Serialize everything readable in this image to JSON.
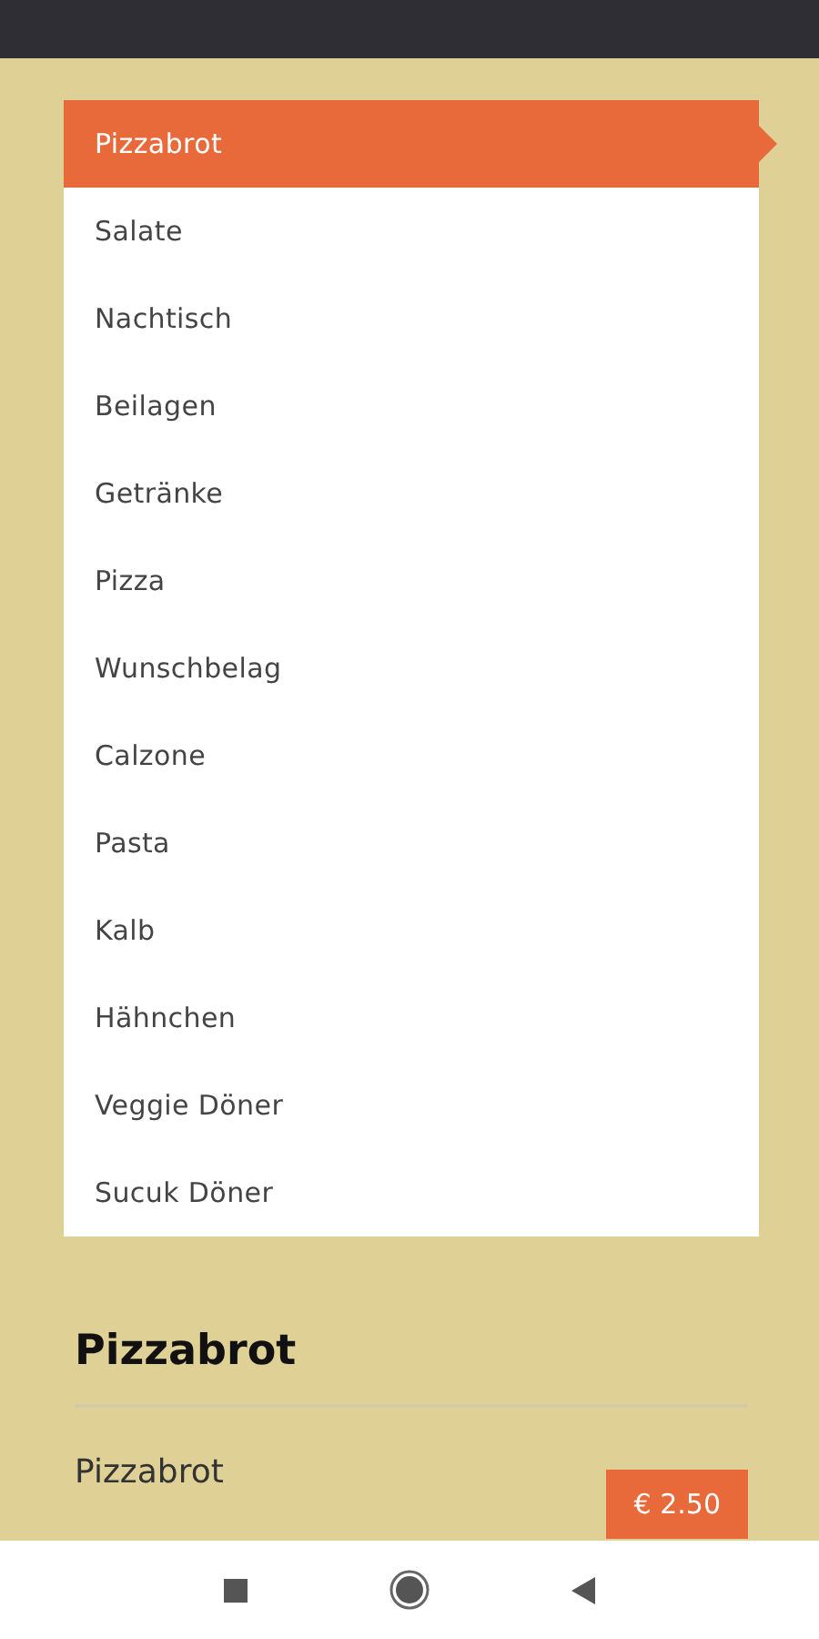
{
  "categories": [
    {
      "label": "Pizzabrot",
      "selected": true
    },
    {
      "label": "Salate",
      "selected": false
    },
    {
      "label": "Nachtisch",
      "selected": false
    },
    {
      "label": "Beilagen",
      "selected": false
    },
    {
      "label": "Getränke",
      "selected": false
    },
    {
      "label": "Pizza",
      "selected": false
    },
    {
      "label": "Wunschbelag",
      "selected": false
    },
    {
      "label": "Calzone",
      "selected": false
    },
    {
      "label": "Pasta",
      "selected": false
    },
    {
      "label": "Kalb",
      "selected": false
    },
    {
      "label": "Hähnchen",
      "selected": false
    },
    {
      "label": "Veggie Döner",
      "selected": false
    },
    {
      "label": "Sucuk Döner",
      "selected": false
    }
  ],
  "section": {
    "title": "Pizzabrot",
    "products": [
      {
        "name": "Pizzabrot",
        "price": "€ 2.50"
      }
    ]
  }
}
